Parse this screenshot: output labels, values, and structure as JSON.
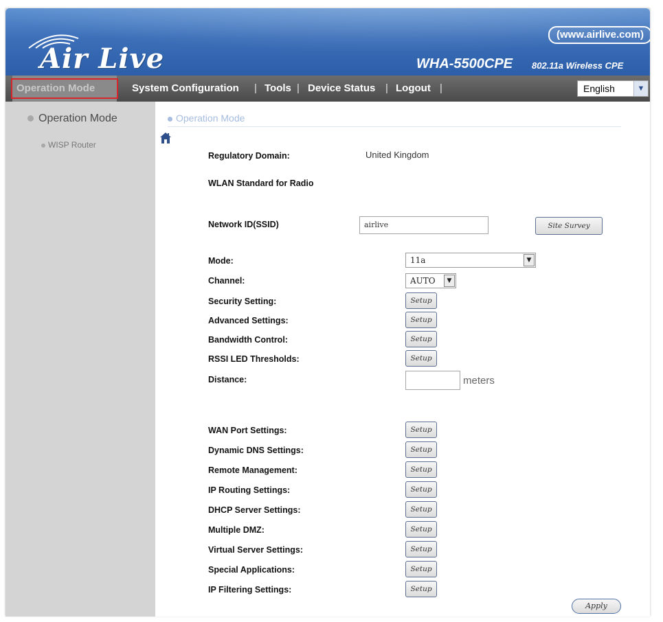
{
  "header": {
    "logo_text": "Air Live",
    "url": "www.airlive.com",
    "model": "WHA-5500CPE",
    "model_description": "802.11a Wireless CPE"
  },
  "nav": {
    "items": [
      {
        "label": "Operation Mode",
        "active": true
      },
      {
        "label": "System Configuration"
      },
      {
        "label": "Tools"
      },
      {
        "label": "Device Status"
      },
      {
        "label": "Logout"
      }
    ],
    "separator": "|",
    "language": "English"
  },
  "sidebar": {
    "items": [
      {
        "label": "Operation Mode"
      },
      {
        "label": "WISP Router"
      }
    ]
  },
  "main": {
    "title": "Operation Mode",
    "regulatory_domain_label": "Regulatory Domain:",
    "regulatory_domain_value": "United Kingdom",
    "wlan_standard_label": "WLAN Standard for Radio",
    "ssid_label": "Network ID(SSID)",
    "ssid_value": "airlive",
    "site_survey_label": "Site Survey",
    "mode_label": "Mode:",
    "mode_value": "11a",
    "channel_label": "Channel:",
    "channel_value": "AUTO",
    "setup_label": "Setup",
    "distance_label": "Distance:",
    "distance_value": "",
    "distance_unit": "meters",
    "radio_setup_rows": [
      "Security Setting:",
      "Advanced Settings:",
      "Bandwidth Control:",
      "RSSI LED Thresholds:"
    ],
    "router_setup_rows": [
      "WAN Port Settings:",
      "Dynamic DNS Settings:",
      "Remote Management:",
      "IP Routing Settings:",
      "DHCP Server Settings:",
      "Multiple DMZ:",
      "Virtual Server Settings:",
      "Special Applications:",
      "IP Filtering Settings:"
    ],
    "apply_label": "Apply"
  }
}
